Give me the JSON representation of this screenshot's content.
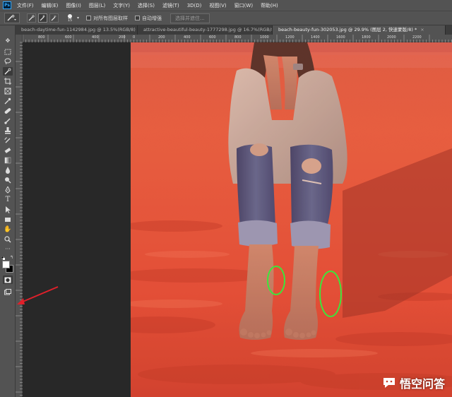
{
  "app": {
    "logo_text": "Ps",
    "menu": [
      "文件(F)",
      "编辑(E)",
      "图像(I)",
      "图层(L)",
      "文字(Y)",
      "选择(S)",
      "滤镜(T)",
      "3D(D)",
      "视图(V)",
      "窗口(W)",
      "帮助(H)"
    ]
  },
  "options_bar": {
    "brush_size": "15",
    "sample_all_layers_label": "对所有图层取样",
    "auto_enhance_label": "自动增强",
    "select_subject_label": "选择并遮住..."
  },
  "tabs": [
    {
      "label": "beach-daytime-fun-1142984.jpg @ 13.5%(RGB/8) *",
      "active": false
    },
    {
      "label": "attractive-beautiful-beauty-1777298.jpg @ 16.7%(RGB/8)",
      "active": false
    },
    {
      "label": "beach-beauty-fun-302053.jpg @ 29.9% (图层 2, 快速蒙版/8) *",
      "active": true
    }
  ],
  "ruler_labels": [
    "800",
    "600",
    "400",
    "200",
    "0",
    "200",
    "400",
    "600",
    "800",
    "1000",
    "1200",
    "1400",
    "1600",
    "1800",
    "2000",
    "2200"
  ],
  "watermark": {
    "text": "悟空问答"
  },
  "colors": {
    "accent": "#31a8ff",
    "mask_red": "#e0452b",
    "annotation_green": "#3ce63c",
    "annotation_arrow": "#e0202a"
  }
}
